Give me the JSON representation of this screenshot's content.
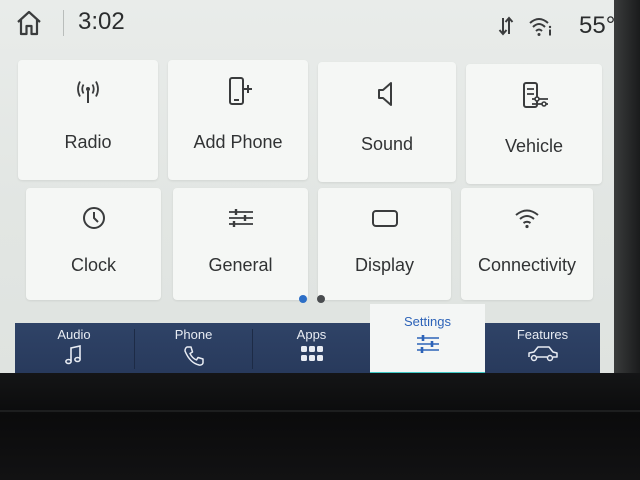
{
  "status_bar": {
    "time": "3:02",
    "temperature": "55°",
    "icons": [
      "home-icon",
      "data-transfer-icon",
      "wifi-info-icon"
    ]
  },
  "settings_tiles": [
    {
      "label": "Radio",
      "icon": "radio-signal-icon"
    },
    {
      "label": "Add Phone",
      "icon": "add-phone-icon"
    },
    {
      "label": "Sound",
      "icon": "speaker-icon"
    },
    {
      "label": "Vehicle",
      "icon": "vehicle-settings-icon"
    },
    {
      "label": "Clock",
      "icon": "clock-icon"
    },
    {
      "label": "General",
      "icon": "sliders-icon"
    },
    {
      "label": "Display",
      "icon": "display-icon"
    },
    {
      "label": "Connectivity",
      "icon": "wifi-icon"
    }
  ],
  "pagination": {
    "pages": 2,
    "current": 1
  },
  "nav": {
    "items": [
      {
        "label": "Audio",
        "icon": "music-note-icon"
      },
      {
        "label": "Phone",
        "icon": "phone-icon"
      },
      {
        "label": "Apps",
        "icon": "apps-grid-icon"
      },
      {
        "label": "Settings",
        "icon": "settings-sliders-icon"
      },
      {
        "label": "Features",
        "icon": "car-icon"
      }
    ],
    "active": "Settings"
  },
  "colors": {
    "accent": "#2d63b8",
    "active_underline": "#3fc9c5",
    "nav_background": "#2f4367",
    "tile_background": "#f5f7f5",
    "dot_active": "#2d6fc7",
    "dot_inactive": "#4a4d50"
  }
}
